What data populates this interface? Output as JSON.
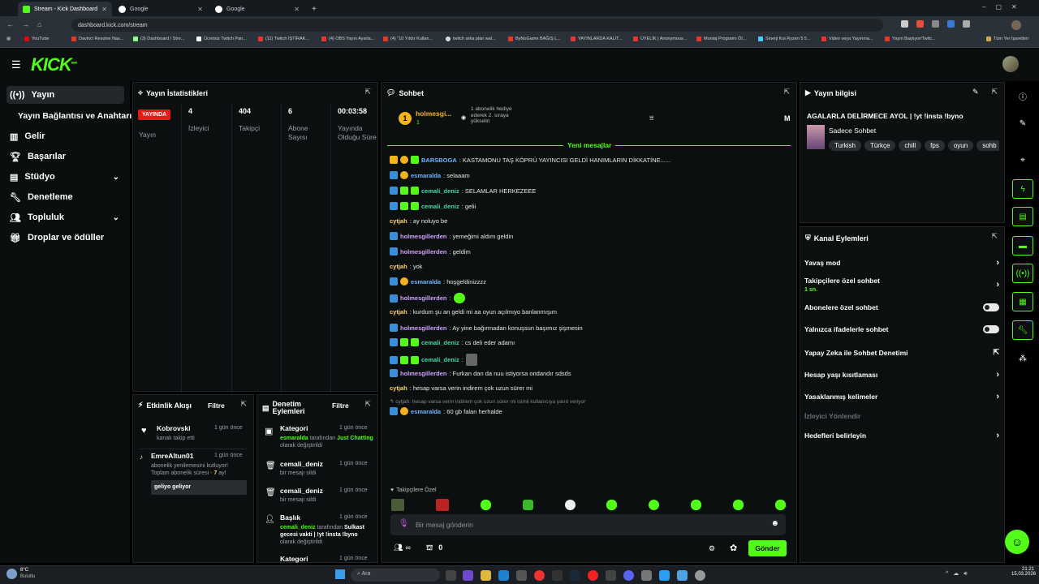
{
  "browser": {
    "tabs": [
      {
        "title": "Stream - Kick Dashboard",
        "active": true
      },
      {
        "title": "Google",
        "active": false
      },
      {
        "title": "Google",
        "active": false
      }
    ],
    "new_tab": "+",
    "url": "dashboard.kick.com/stream",
    "bookmarks": [
      "YouTube",
      "Davinci Resolve Nas...",
      "(3) Dashboard / Stre...",
      "Ücretsiz Twitch Pan...",
      "(11) Twitch İŞTİRAK...",
      "(4) OBS Yayın Ayarla...",
      "(4) \"10 Yıldır Kullan...",
      "twitch arka plan wal...",
      "ByNoGame BAĞIŞ L...",
      "YAYINLARDA KALIT...",
      "ÜYELİK | Anonymous...",
      "Montaj Programı Öl...",
      "Sinerji Koi Ryzen 5 5...",
      "Video veya Yayınına...",
      "Yayın Başlıyor/Twitc..."
    ],
    "all_bookmarks": "Tüm Yer İşaretleri"
  },
  "header": {
    "logo": "KICK",
    "logo_sup": "BETA"
  },
  "nav": [
    {
      "label": "Yayın",
      "icon": "stream-icon",
      "active": true
    },
    {
      "label": "Yayın Bağlantısı ve Anahtarı",
      "icon": "",
      "active": false
    },
    {
      "label": "Gelir",
      "icon": "revenue-icon",
      "active": false
    },
    {
      "label": "Başarılar",
      "icon": "trophy-icon",
      "active": false
    },
    {
      "label": "Stüdyo",
      "icon": "studio-icon",
      "active": false,
      "chevron": "⌄"
    },
    {
      "label": "Denetleme",
      "icon": "wrench-icon",
      "active": false
    },
    {
      "label": "Topluluk",
      "icon": "community-icon",
      "active": false,
      "chevron": "⌄"
    },
    {
      "label": "Droplar ve ödüller",
      "icon": "gift-icon",
      "active": false
    }
  ],
  "stats": {
    "title": "Yayın İstatistikleri",
    "live_badge": "YAYINDA",
    "live_label": "Yayın",
    "viewers": {
      "value": "4",
      "label": "İzleyici"
    },
    "followers": {
      "value": "404",
      "label": "Takipçi"
    },
    "subs": {
      "value": "6",
      "label": "Abone Sayısı"
    },
    "duration": {
      "value": "00:03:58",
      "label": "Yayında Olduğu Süre"
    }
  },
  "chat": {
    "title": "Sohbet",
    "pinned_user": "holmesgi...",
    "pinned_count": "1",
    "pinned_text": "1 abonelik hediye ederek 2. sıraya yükselin",
    "pinned_right": "M",
    "new_messages": "Yeni mesajlar",
    "messages": [
      {
        "user": "BARSBOGA",
        "cls": "u3",
        "text": ": KASTAMONU TAŞ KÖPRÜ YAYINCISI GELDİ HANIMLARIN DİKKATİNE......"
      },
      {
        "user": "esmaralda",
        "cls": "u3",
        "text": ": selaaam"
      },
      {
        "user": "cemali_deniz",
        "cls": "u6",
        "text": ": SELAMLAR HERKEZEEE"
      },
      {
        "user": "cemali_deniz",
        "cls": "u6",
        "text": ": gelii"
      },
      {
        "user": "cytjah",
        "cls": "u4",
        "text": ": ay noluyo be"
      },
      {
        "user": "holmesgillerden",
        "cls": "u5",
        "text": ": yemeğimi aldım geldin"
      },
      {
        "user": "holmesgillerden",
        "cls": "u5",
        "text": ": geldim"
      },
      {
        "user": "cytjah",
        "cls": "u4",
        "text": ": yok"
      },
      {
        "user": "esmaralda",
        "cls": "u3",
        "text": ": hoşgeldinizzzz"
      },
      {
        "user": "holmesgillerden",
        "cls": "u5",
        "text": ":"
      },
      {
        "user": "cytjah",
        "cls": "u4",
        "text": ": kurdum şu an geldi mi aa oyun açılmıyo banlanmışım"
      },
      {
        "user": "holmesgillerden",
        "cls": "u5",
        "text": ": Ay yine bağırmadan konuşsun başımız şişmesin"
      },
      {
        "user": "cemali_deniz",
        "cls": "u6",
        "text": ": cs deli eder adamı"
      },
      {
        "user": "cemali_deniz",
        "cls": "u6",
        "text": ":"
      },
      {
        "user": "holmesgillerden",
        "cls": "u5",
        "text": ": Furkan dan da nuu istiyorsa ondandır sdsds"
      },
      {
        "user": "cytjah",
        "cls": "u4",
        "text": ": hesap varsa verin indirem çok uzun sürer mi"
      }
    ],
    "reply_hint": "↰ cytjah: hesap varsa verin indirem çok uzun sürer mi isimli kullanıcıya yanıt veriyor",
    "last_msg": {
      "user": "esmaralda",
      "text": ": 60 gb falan herhalde"
    },
    "followers_only": "Takipçilere Özel",
    "input_placeholder": "Bir mesaj gönderin",
    "users_infinite": "∞",
    "store_count": "0",
    "send": "Gönder"
  },
  "activity": {
    "title": "Etkinlik Akışı",
    "filter": "Filtre",
    "items": [
      {
        "user": "Kobrovski",
        "time": "1 gün önce",
        "desc": "kanalı takip etti"
      },
      {
        "user": "EmreAltun01",
        "time": "1 gün önce",
        "desc": "abonelik yenilemesini kutluyor! Toplam abonelik süresi - ",
        "months": "7",
        "desc2": " ay!",
        "note": "geliyo geliyor"
      }
    ]
  },
  "moderation": {
    "title": "Denetim Eylemleri",
    "filter": "Filtre",
    "items": [
      {
        "title": "Kategori",
        "time": "1 gün önce",
        "u": "esmaralda",
        "mid": " tarafından ",
        "hl": "Just Chatting",
        "end": " olarak değiştirildi"
      },
      {
        "title": "cemali_deniz",
        "time": "1 gün önce",
        "desc": "bir mesajı sildi"
      },
      {
        "title": "cemali_deniz",
        "time": "1 gün önce",
        "desc": "bir mesajı sildi"
      },
      {
        "title": "Başlık",
        "time": "1 gün önce",
        "u": "cemali_deniz",
        "mid": " tarafından ",
        "hl": "Sulkast gecesi vakti | !yt !insta !byno",
        "end": " olarak değiştirildi"
      },
      {
        "title": "Kategori",
        "time": "1 gün önce"
      }
    ]
  },
  "streaminfo": {
    "title": "Yayın bilgisi",
    "stream_title": "AGALARLA DELİRMECE AYOL | !yt !insta !byno",
    "category": "Sadece Sohbet",
    "tags": [
      "Turkish",
      "Türkçe",
      "chill",
      "fps",
      "oyun",
      "sohb"
    ]
  },
  "channel_actions": {
    "title": "Kanal Eylemleri",
    "slow": "Yavaş mod",
    "followers": "Takipçilere özel sohbet",
    "followers_time": "1 sn.",
    "subs": "Abonelere özel sohbet",
    "emotes": "Yalnızca ifadelerle sohbet",
    "ai": "Yapay Zeka ile Sohbet Denetimi",
    "age": "Hesap yaşı kısıtlaması",
    "banned": "Yasaklanmış kelimeler",
    "redirect": "İzleyici Yönlendir",
    "goals": "Hedefleri belirleyin"
  },
  "taskbar": {
    "weather_temp": "8°C",
    "weather_desc": "Bulutlu",
    "search": "Ara",
    "time": "21:21",
    "date": "15.03.2026"
  },
  "colors": {
    "brand": "#53fc18",
    "live": "#e91916",
    "panel": "#0c0f10"
  }
}
